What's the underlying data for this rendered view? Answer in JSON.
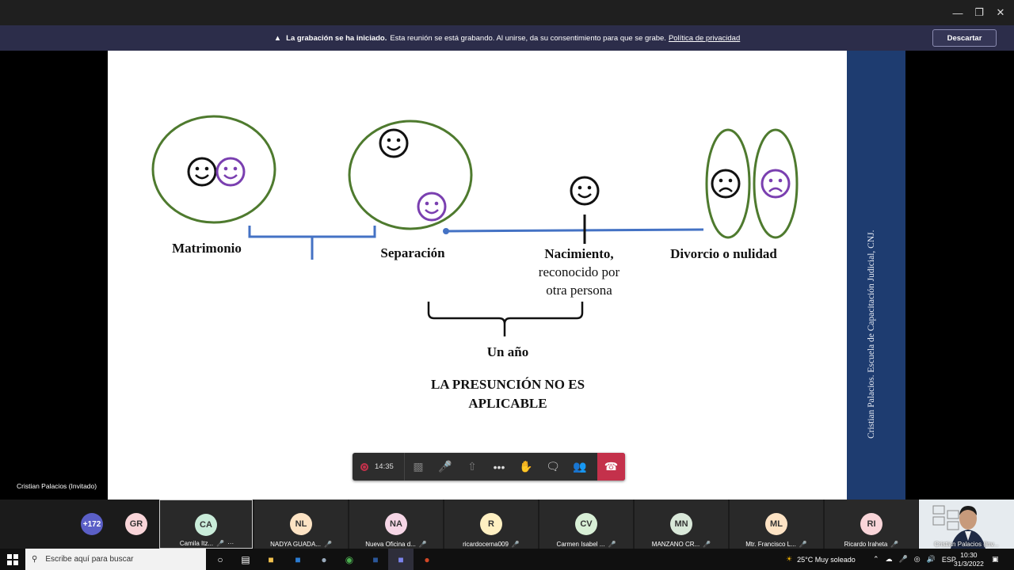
{
  "banner": {
    "bold": "La grabación se ha iniciado.",
    "text": "Esta reunión se está grabando. Al unirse, da su consentimiento para que se grabe.",
    "link": "Política de privacidad",
    "dismiss": "Descartar"
  },
  "slide": {
    "matrimonio": "Matrimonio",
    "separacion": "Separación",
    "nacimiento": "Nacimiento,",
    "reconocido1": "reconocido por",
    "reconocido2": "otra persona",
    "divorcio": "Divorcio o nulidad",
    "unano": "Un año",
    "presuncion1": "LA PRESUNCIÓN NO ES",
    "presuncion2": "APLICABLE",
    "side_text": "Cristian Palacios. Escuela de Capacitación Judicial, CNJ."
  },
  "presenter_label": "Cristian Palacios (Invitado)",
  "controls": {
    "timer": "14:35"
  },
  "participants": {
    "more_count": "+172",
    "gr": "GR",
    "tiles": [
      {
        "initials": "CA",
        "name": "Camila Itz...",
        "color": "#c9ecd9"
      },
      {
        "initials": "NL",
        "name": "NADYA GUADA...",
        "color": "#fde3c4"
      },
      {
        "initials": "NA",
        "name": "Nueva Oficina d...",
        "color": "#f6d6e6"
      },
      {
        "initials": "R",
        "name": "ricardocerna009",
        "color": "#fff0c2"
      },
      {
        "initials": "CV",
        "name": "Carmen Isabel ...",
        "color": "#d8efd6"
      },
      {
        "initials": "MN",
        "name": "MANZANO CR...",
        "color": "#d9e8d9"
      },
      {
        "initials": "ML",
        "name": "Mtr. Francisco L...",
        "color": "#fde3c4"
      },
      {
        "initials": "RI",
        "name": "Ricardo Iraheta",
        "color": "#f9d5d9"
      }
    ],
    "self_name": "Cristian Palacios (Inv..."
  },
  "taskbar": {
    "search_placeholder": "Escribe aquí para buscar",
    "weather": "25°C  Muy soleado",
    "lang": "ESP",
    "time": "10:30",
    "date": "31/3/2022"
  }
}
